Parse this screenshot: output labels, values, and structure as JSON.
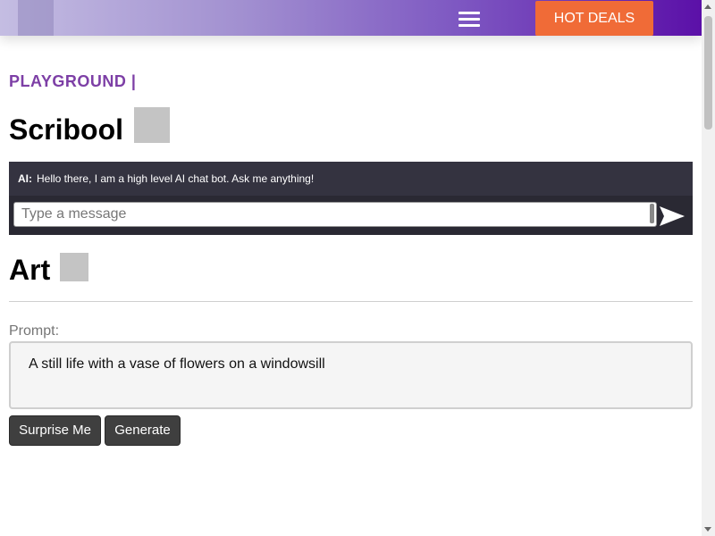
{
  "header": {
    "hot_deals_label": "HOT DEALS",
    "menu_icon": "hamburger-icon",
    "accent_color": "#f06b37",
    "gradient_colors": [
      "#c4bde2",
      "#5b10a8"
    ]
  },
  "section_label": "PLAYGROUND |",
  "scribool": {
    "title": "Scribool",
    "chat": {
      "sender": "AI:",
      "message": "Hello there, I am a high level AI chat bot. Ask me anything!",
      "input_placeholder": "Type a message",
      "send_icon": "send-icon"
    }
  },
  "art": {
    "title": "Art",
    "prompt_label": "Prompt:",
    "prompt_value": "A still life with a vase of flowers on a windowsill",
    "surprise_label": "Surprise Me",
    "generate_label": "Generate"
  }
}
